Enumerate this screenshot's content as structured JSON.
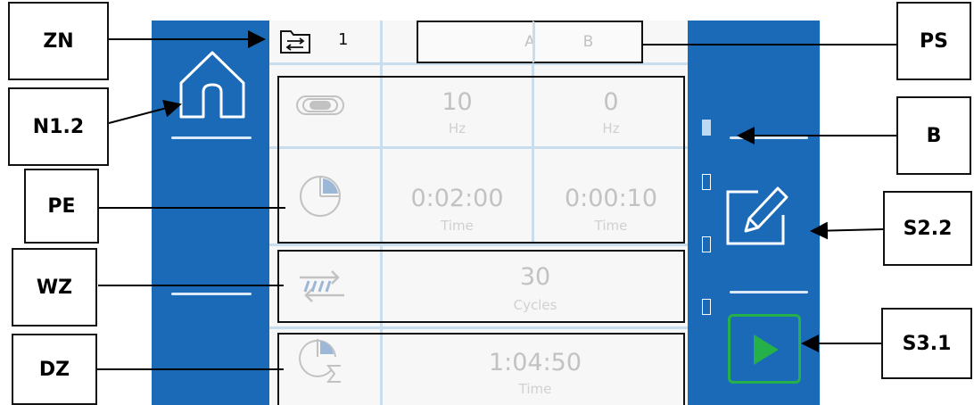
{
  "callouts": {
    "zn": "ZN",
    "n12": "N1.2",
    "pe": "PE",
    "wz": "WZ",
    "dz": "DZ",
    "ps": "PS",
    "b": "B",
    "s22": "S2.2",
    "s31": "S3.1"
  },
  "header": {
    "zone_number": "1",
    "preset_a": "A",
    "preset_b": "B"
  },
  "frequency": {
    "a_value": "10",
    "a_unit": "Hz",
    "b_value": "0",
    "b_unit": "Hz"
  },
  "time": {
    "a_value": "0:02:00",
    "a_unit": "Time",
    "b_value": "0:00:10",
    "b_unit": "Time"
  },
  "cycles": {
    "value": "30",
    "unit": "Cycles"
  },
  "total": {
    "value": "1:04:50",
    "unit": "Time"
  },
  "colors": {
    "panel_blue": "#1a6ab8",
    "start_green": "#25b04a",
    "muted_text": "#c2c2c2"
  },
  "icons": {
    "zone": "folder-arrows-icon",
    "home": "home-icon",
    "vibration": "vibration-icon",
    "clock": "pie-clock-icon",
    "cycles": "cycle-arrows-icon",
    "total": "clock-sum-icon",
    "edit": "edit-pencil-icon",
    "play": "play-icon"
  },
  "indicator": {
    "active_index": 0,
    "count": 4
  }
}
